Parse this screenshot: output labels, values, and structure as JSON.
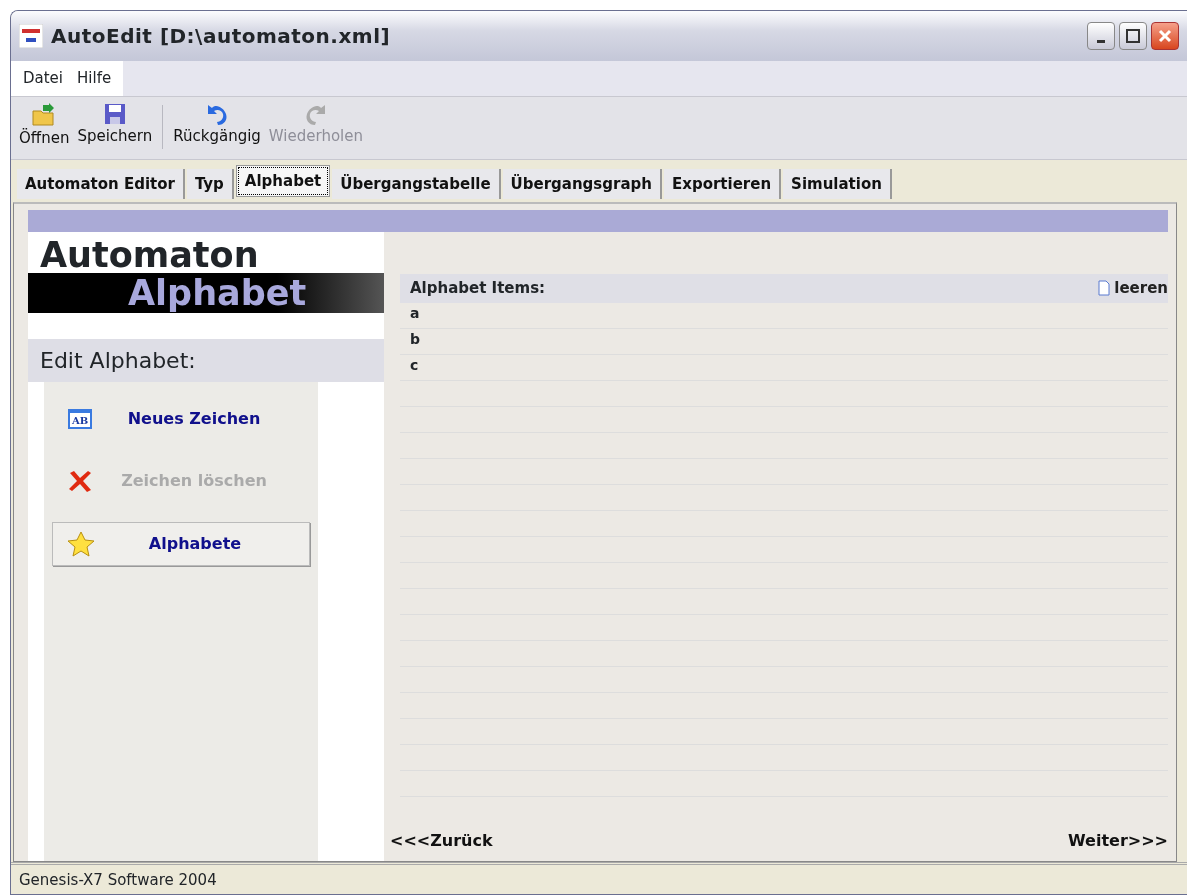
{
  "window": {
    "title": "AutoEdit [D:\\automaton.xml]"
  },
  "menu": [
    "Datei",
    "Hilfe"
  ],
  "toolbar": [
    {
      "label": "Öffnen",
      "disabled": false
    },
    {
      "label": "Speichern",
      "disabled": false
    },
    {
      "label": "Rückgängig",
      "disabled": false
    },
    {
      "label": "Wiederholen",
      "disabled": true
    }
  ],
  "tabs": [
    {
      "label": "Automaton Editor",
      "selected": false
    },
    {
      "label": "Typ",
      "selected": false
    },
    {
      "label": "Alphabet",
      "selected": true
    },
    {
      "label": "Übergangstabelle",
      "selected": false
    },
    {
      "label": "Übergangsgraph",
      "selected": false
    },
    {
      "label": "Exportieren",
      "selected": false
    },
    {
      "label": "Simulation",
      "selected": false
    }
  ],
  "banner": {
    "line_1": "Automaton",
    "line_2": "Alphabet"
  },
  "sidebar": {
    "heading": "Edit Alphabet:",
    "actions": [
      {
        "label": "Neues Zeichen",
        "icon_text": "AB",
        "disabled": false,
        "kind": "link"
      },
      {
        "label": "Zeichen löschen",
        "disabled": true,
        "kind": "link"
      },
      {
        "label": "Alphabete",
        "disabled": false,
        "kind": "button"
      }
    ]
  },
  "items": {
    "heading": "Alphabet Items:",
    "clear_label": "leeren",
    "rows": [
      "a",
      "b",
      "c"
    ]
  },
  "nav": {
    "back": "<<<Zurück",
    "next": "Weiter>>>"
  },
  "status_bar": "Genesis-X7 Software 2004"
}
